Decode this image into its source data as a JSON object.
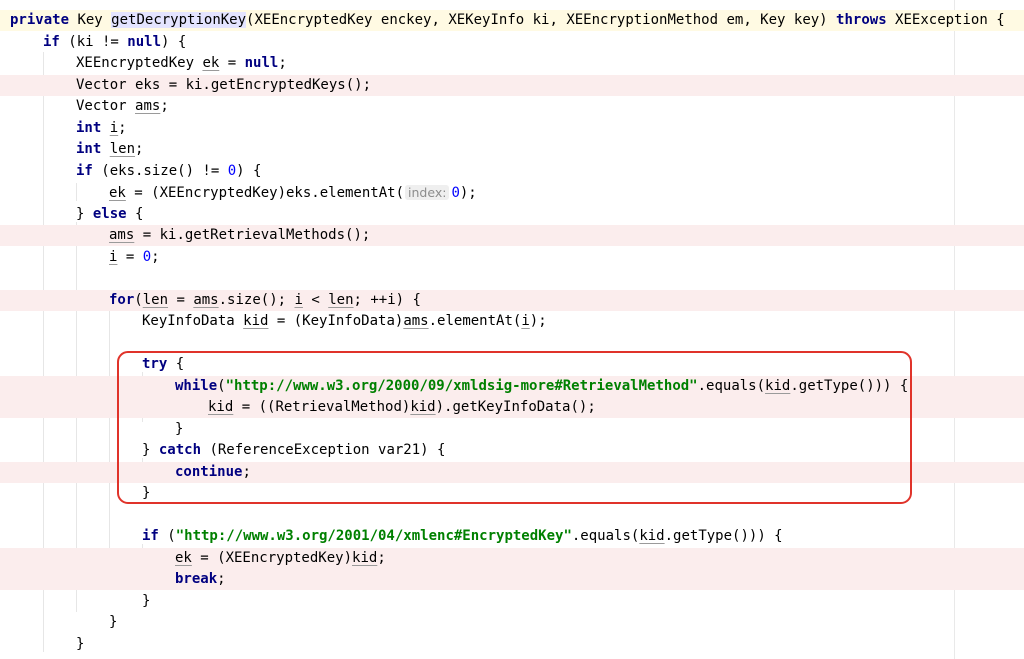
{
  "lines": [
    {
      "highlight": "yellow",
      "segments": [
        {
          "t": "private",
          "c": "kw"
        },
        {
          "t": " Key "
        },
        {
          "t": "getDecryptionKey",
          "c": "fnhl"
        },
        {
          "t": "(XEEncryptedKey enckey, XEKeyInfo ki, XEEncryptionMethod em, Key key) "
        },
        {
          "t": "throws",
          "c": "kw"
        },
        {
          "t": " XEException {"
        }
      ]
    },
    {
      "highlight": "none",
      "segments": [
        {
          "t": "if",
          "c": "kw"
        },
        {
          "t": " (ki != "
        },
        {
          "t": "null",
          "c": "kw"
        },
        {
          "t": ") {"
        }
      ]
    },
    {
      "highlight": "none",
      "segments": [
        {
          "t": "XEEncryptedKey "
        },
        {
          "t": "ek",
          "c": "u"
        },
        {
          "t": " = "
        },
        {
          "t": "null",
          "c": "kw"
        },
        {
          "t": ";"
        }
      ]
    },
    {
      "highlight": "pink",
      "segments": [
        {
          "t": "Vector eks = ki.getEncryptedKeys();"
        }
      ]
    },
    {
      "highlight": "none",
      "segments": [
        {
          "t": "Vector "
        },
        {
          "t": "ams",
          "c": "u"
        },
        {
          "t": ";"
        }
      ]
    },
    {
      "highlight": "none",
      "segments": [
        {
          "t": "int",
          "c": "kw"
        },
        {
          "t": " "
        },
        {
          "t": "i",
          "c": "u"
        },
        {
          "t": ";"
        }
      ]
    },
    {
      "highlight": "none",
      "segments": [
        {
          "t": "int",
          "c": "kw"
        },
        {
          "t": " "
        },
        {
          "t": "len",
          "c": "u"
        },
        {
          "t": ";"
        }
      ]
    },
    {
      "highlight": "none",
      "segments": [
        {
          "t": "if",
          "c": "kw"
        },
        {
          "t": " (eks.size() != "
        },
        {
          "t": "0",
          "c": "num"
        },
        {
          "t": ") {"
        }
      ]
    },
    {
      "highlight": "none",
      "segments": [
        {
          "t": "ek",
          "c": "u"
        },
        {
          "t": " = (XEEncryptedKey)eks.elementAt("
        },
        {
          "t": "index:",
          "c": "hint"
        },
        {
          "t": "0",
          "c": "num"
        },
        {
          "t": ");"
        }
      ]
    },
    {
      "highlight": "none",
      "segments": [
        {
          "t": "} "
        },
        {
          "t": "else",
          "c": "kw"
        },
        {
          "t": " {"
        }
      ]
    },
    {
      "highlight": "pink",
      "segments": [
        {
          "t": "ams",
          "c": "u"
        },
        {
          "t": " = ki.getRetrievalMethods();"
        }
      ]
    },
    {
      "highlight": "none",
      "segments": [
        {
          "t": "i",
          "c": "u"
        },
        {
          "t": " = "
        },
        {
          "t": "0",
          "c": "num"
        },
        {
          "t": ";"
        }
      ]
    },
    {
      "highlight": "none",
      "segments": []
    },
    {
      "highlight": "pink",
      "segments": [
        {
          "t": "for",
          "c": "kw"
        },
        {
          "t": "("
        },
        {
          "t": "len",
          "c": "u"
        },
        {
          "t": " = "
        },
        {
          "t": "ams",
          "c": "u"
        },
        {
          "t": ".size(); "
        },
        {
          "t": "i",
          "c": "u"
        },
        {
          "t": " < "
        },
        {
          "t": "len",
          "c": "u"
        },
        {
          "t": "; ++i) {"
        }
      ]
    },
    {
      "highlight": "none",
      "segments": [
        {
          "t": "KeyInfoData "
        },
        {
          "t": "kid",
          "c": "u"
        },
        {
          "t": " = (KeyInfoData)"
        },
        {
          "t": "ams",
          "c": "u"
        },
        {
          "t": ".elementAt("
        },
        {
          "t": "i",
          "c": "u"
        },
        {
          "t": ");"
        }
      ]
    },
    {
      "highlight": "none",
      "segments": []
    },
    {
      "highlight": "none",
      "segments": [
        {
          "t": "try",
          "c": "kw"
        },
        {
          "t": " {"
        }
      ]
    },
    {
      "highlight": "pink",
      "segments": [
        {
          "t": "while",
          "c": "kw"
        },
        {
          "t": "("
        },
        {
          "t": "\"http://www.w3.org/2000/09/xmldsig-more#RetrievalMethod\"",
          "c": "str"
        },
        {
          "t": ".equals("
        },
        {
          "t": "kid",
          "c": "u"
        },
        {
          "t": ".getType())) {"
        }
      ]
    },
    {
      "highlight": "pink",
      "segments": [
        {
          "t": "kid",
          "c": "u"
        },
        {
          "t": " = ((RetrievalMethod)"
        },
        {
          "t": "kid",
          "c": "u"
        },
        {
          "t": ").getKeyInfoData();"
        }
      ]
    },
    {
      "highlight": "none",
      "segments": [
        {
          "t": "}"
        }
      ]
    },
    {
      "highlight": "none",
      "segments": [
        {
          "t": "} "
        },
        {
          "t": "catch",
          "c": "kw"
        },
        {
          "t": " (ReferenceException var21) {"
        }
      ]
    },
    {
      "highlight": "pink",
      "segments": [
        {
          "t": "continue",
          "c": "kw"
        },
        {
          "t": ";"
        }
      ]
    },
    {
      "highlight": "none",
      "segments": [
        {
          "t": "}"
        }
      ]
    },
    {
      "highlight": "none",
      "segments": []
    },
    {
      "highlight": "none",
      "segments": [
        {
          "t": "if",
          "c": "kw"
        },
        {
          "t": " ("
        },
        {
          "t": "\"http://www.w3.org/2001/04/xmlenc#EncryptedKey\"",
          "c": "str"
        },
        {
          "t": ".equals("
        },
        {
          "t": "kid",
          "c": "u"
        },
        {
          "t": ".getType())) {"
        }
      ]
    },
    {
      "highlight": "pink",
      "segments": [
        {
          "t": "ek",
          "c": "u"
        },
        {
          "t": " = (XEEncryptedKey)"
        },
        {
          "t": "kid",
          "c": "u"
        },
        {
          "t": ";"
        }
      ]
    },
    {
      "highlight": "pink",
      "segments": [
        {
          "t": "break",
          "c": "kw"
        },
        {
          "t": ";"
        }
      ]
    },
    {
      "highlight": "none",
      "segments": [
        {
          "t": "}"
        }
      ]
    },
    {
      "highlight": "none",
      "segments": [
        {
          "t": "}"
        }
      ]
    },
    {
      "highlight": "none",
      "segments": [
        {
          "t": "}"
        }
      ]
    }
  ],
  "colors": {
    "keyword": "#000080",
    "string": "#008000",
    "number": "#0000ff",
    "current_line": "#fffae3",
    "line_highlight": "#fbeded",
    "callout_border": "#e0332a"
  }
}
